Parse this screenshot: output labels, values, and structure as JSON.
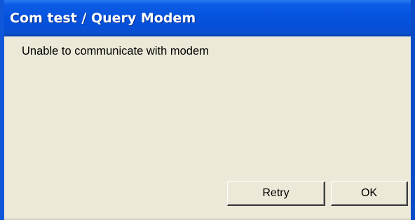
{
  "dialog": {
    "title": "Com test / Query Modem",
    "message": "Unable to communicate with modem"
  },
  "buttons": {
    "retry_label": "Retry",
    "ok_label": "OK"
  },
  "colors": {
    "titlebar": "#0653de",
    "dialog_background": "#ece9d8",
    "frame": "#0f57d8"
  }
}
